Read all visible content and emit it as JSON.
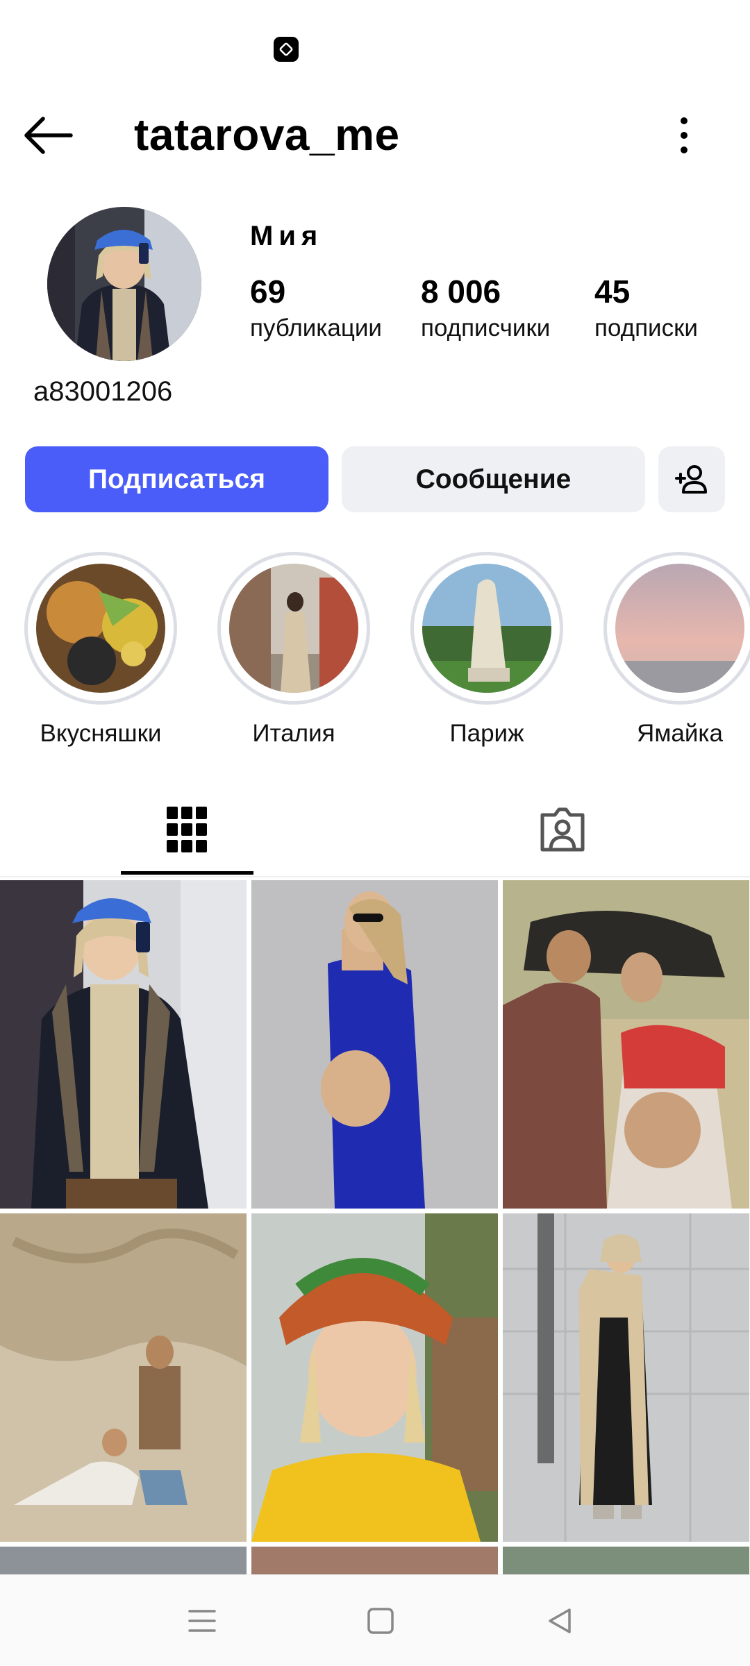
{
  "header": {
    "username": "tatarova_me"
  },
  "profile": {
    "display_name": "Мия",
    "handle": "a83001206",
    "stats": [
      {
        "number": "69",
        "label": "публикации"
      },
      {
        "number": "8 006",
        "label": "подписчики"
      },
      {
        "number": "45",
        "label": "подписки"
      }
    ]
  },
  "actions": {
    "follow": "Подписаться",
    "message": "Сообщение"
  },
  "highlights": [
    {
      "label": "Вкусняшки"
    },
    {
      "label": "Италия"
    },
    {
      "label": "Париж"
    },
    {
      "label": "Ямайка"
    }
  ],
  "colors": {
    "accent": "#4a5df9",
    "secondary_button": "#eff0f4"
  },
  "icons": {
    "back": "arrow-left-icon",
    "more": "more-vertical-icon",
    "add_user": "add-user-icon",
    "grid_tab": "grid-icon",
    "tagged_tab": "tagged-icon",
    "nav_menu": "menu-icon",
    "nav_home": "square-icon",
    "nav_back": "triangle-back-icon"
  }
}
